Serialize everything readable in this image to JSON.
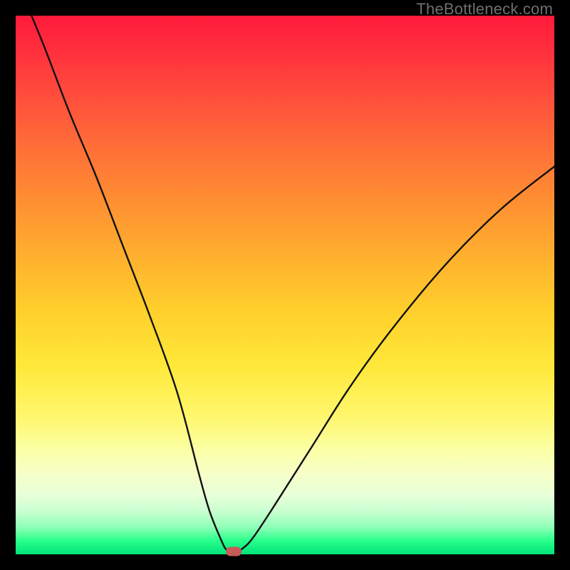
{
  "watermark": "TheBottleneck.com",
  "colors": {
    "frame": "#000000",
    "curve_stroke": "#111111",
    "marker": "#c65b57"
  },
  "chart_data": {
    "type": "line",
    "title": "",
    "xlabel": "",
    "ylabel": "",
    "xlim": [
      0,
      100
    ],
    "ylim": [
      0,
      100
    ],
    "grid": false,
    "legend_position": "none",
    "series": [
      {
        "name": "bottleneck-curve",
        "x": [
          0,
          5,
          10,
          15,
          20,
          25,
          30,
          34,
          36,
          38,
          39,
          40,
          41,
          42,
          44,
          48,
          55,
          62,
          70,
          80,
          90,
          100
        ],
        "values": [
          107,
          95,
          82,
          70,
          57,
          44,
          30,
          15,
          8,
          3,
          1,
          0.5,
          0.5,
          1,
          3,
          9,
          20,
          31,
          42,
          54,
          64,
          72
        ]
      }
    ],
    "annotations": [
      {
        "name": "optimal-marker",
        "x": 40.5,
        "y": 0.5,
        "shape": "pill"
      }
    ]
  }
}
